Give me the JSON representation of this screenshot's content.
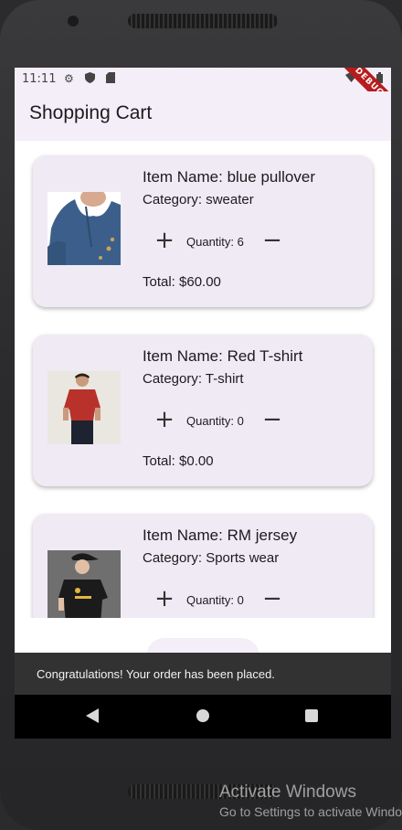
{
  "status_bar": {
    "time": "11:11",
    "debug_label": "DEBUG"
  },
  "app_bar": {
    "title": "Shopping Cart"
  },
  "cart_items": [
    {
      "name": "Item Name: blue pullover",
      "category": "Category: sweater",
      "quantity": "Quantity: 6",
      "total": "Total: $60.00",
      "image_colors": {
        "bg": "#ffffff",
        "garment": "#3b5f8a",
        "skin": "#d7a98e"
      }
    },
    {
      "name": "Item Name: Red T-shirt",
      "category": "Category: T-shirt",
      "quantity": "Quantity: 0",
      "total": "Total: $0.00",
      "image_colors": {
        "bg": "#eae7e1",
        "garment": "#b8322b",
        "skin": "#c99a7c"
      }
    },
    {
      "name": "Item Name: RM jersey",
      "category": "Category: Sports wear",
      "quantity": "Quantity: 0",
      "total": "",
      "image_colors": {
        "bg": "#6f6f6f",
        "garment": "#1b1b1b",
        "skin": "#e0bfa4"
      }
    }
  ],
  "snackbar": {
    "message": "Congratulations! Your order has been placed."
  },
  "watermark": {
    "line1": "Activate Windows",
    "line2": "Go to Settings to activate Windows."
  }
}
